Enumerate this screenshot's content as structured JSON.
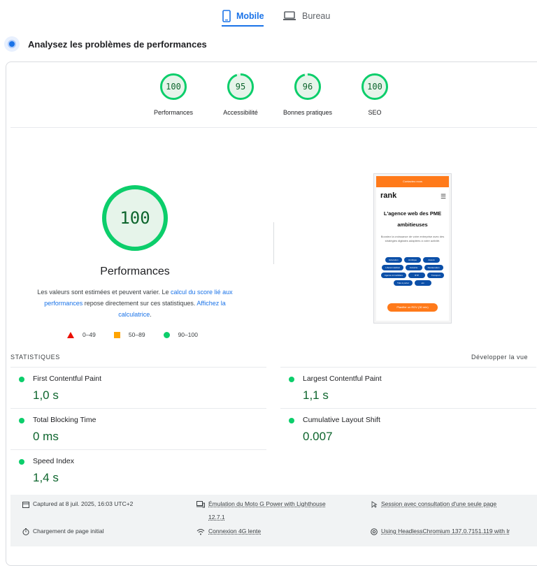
{
  "tabs": {
    "mobile": "Mobile",
    "desktop": "Bureau"
  },
  "section_title": "Analysez les problèmes de performances",
  "categories": [
    {
      "label": "Performances",
      "score": "100",
      "value": 100
    },
    {
      "label": "Accessibilité",
      "score": "95",
      "value": 95
    },
    {
      "label": "Bonnes pratiques",
      "score": "96",
      "value": 96
    },
    {
      "label": "SEO",
      "score": "100",
      "value": 100
    }
  ],
  "main": {
    "score": "100",
    "title": "Performances",
    "desc_1": "Les valeurs sont estimées et peuvent varier. Le ",
    "desc_link_1": "calcul du score lié aux performances",
    "desc_2": " repose directement sur ces statistiques. ",
    "desc_link_2": "Affichez la calculatrice",
    "desc_3": "."
  },
  "legend": {
    "poor": "0–49",
    "average": "50–89",
    "good": "90–100"
  },
  "screenshot": {
    "bar": "Contactez-nous",
    "logo": "rank",
    "heading": "L'agence web des PME ambitieuses",
    "paragraph": "Boostez la croissance de votre entreprise avec des stratégies digitales adaptées à votre activité.",
    "pills": [
      "Education",
      "Juridique",
      "Assuré",
      "Libéral médical",
      "Industrie",
      "Restauration",
      "Agence immobilière",
      "BTP",
      "Transport",
      "Télé à porter",
      "etc."
    ],
    "cta": "Planifier un RDV (30 min)",
    "accent": "#ff7a1a"
  },
  "stats": {
    "heading": "STATISTIQUES",
    "expand": "Développer la vue",
    "metrics": [
      {
        "name": "First Contentful Paint",
        "value": "1,0 s"
      },
      {
        "name": "Largest Contentful Paint",
        "value": "1,1 s"
      },
      {
        "name": "Total Blocking Time",
        "value": "0 ms"
      },
      {
        "name": "Cumulative Layout Shift",
        "value": "0.007"
      },
      {
        "name": "Speed Index",
        "value": "1,4 s"
      }
    ]
  },
  "footer": {
    "captured": "Captured at 8 juil. 2025, 16:03 UTC+2",
    "emulation_1": "Émulation du Moto G Power with Lighthouse",
    "emulation_2": "12.7.1",
    "session": "Session avec consultation d'une seule page",
    "initial_load": "Chargement de page initial",
    "connection": "Connexion 4G lente",
    "browser": "Using HeadlessChromium 137.0.7151.119 with lr"
  },
  "colors": {
    "good": "#0cce6b",
    "good_text": "#0d652d",
    "average": "#ffa400",
    "poor": "#eb0f00",
    "accent": "#1a73e8"
  }
}
